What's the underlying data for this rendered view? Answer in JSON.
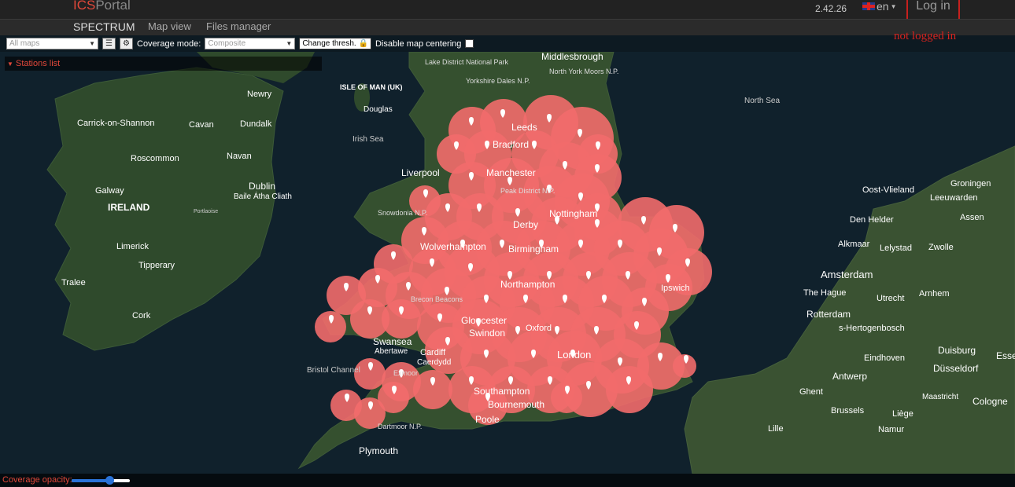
{
  "header": {
    "logo_part1": "ICS",
    "logo_part2": "Portal",
    "version": "2.42.26",
    "language": "en",
    "login_label": "Log in",
    "annotation": "not logged in"
  },
  "nav": {
    "items": [
      {
        "label": "SPECTRUM",
        "active": true
      },
      {
        "label": "Map view",
        "active": false
      },
      {
        "label": "Files manager",
        "active": false
      }
    ]
  },
  "toolbar": {
    "maps_select_value": "All maps",
    "coverage_mode_label": "Coverage mode:",
    "coverage_mode_value": "Composite",
    "change_thresh_label": "Change thresh.",
    "disable_centering_label": "Disable map centering",
    "disable_centering_checked": false
  },
  "stations_list_label": "Stations list",
  "coverage_opacity": {
    "label": "Coverage opacity:",
    "value": 0.65
  },
  "map": {
    "colors": {
      "sea": "#10212c",
      "land": "#2f4a2c",
      "coverage": "#f26b6b",
      "marker": "#ffffff"
    },
    "labels": [
      {
        "text": "Middlesbrough",
        "kind": "city"
      },
      {
        "text": "Lake District National Park",
        "kind": "park"
      },
      {
        "text": "Yorkshire Dales N.P.",
        "kind": "park"
      },
      {
        "text": "North York Moors N.P.",
        "kind": "park"
      },
      {
        "text": "ISLE OF MAN (UK)",
        "kind": "region"
      },
      {
        "text": "Douglas",
        "kind": "city"
      },
      {
        "text": "North Sea",
        "kind": "water"
      },
      {
        "text": "Irish Sea",
        "kind": "water"
      },
      {
        "text": "Newry",
        "kind": "city"
      },
      {
        "text": "Carrick-on-Shannon",
        "kind": "city"
      },
      {
        "text": "Cavan",
        "kind": "city"
      },
      {
        "text": "Dundalk",
        "kind": "city"
      },
      {
        "text": "Roscommon",
        "kind": "city"
      },
      {
        "text": "Navan",
        "kind": "city"
      },
      {
        "text": "Galway",
        "kind": "city"
      },
      {
        "text": "Dublin",
        "kind": "city"
      },
      {
        "text": "Baile Átha Cliath",
        "kind": "city"
      },
      {
        "text": "IRELAND",
        "kind": "country"
      },
      {
        "text": "Portlaoise",
        "kind": "town"
      },
      {
        "text": "Limerick",
        "kind": "city"
      },
      {
        "text": "Tipperary",
        "kind": "city"
      },
      {
        "text": "Tralee",
        "kind": "city"
      },
      {
        "text": "Cork",
        "kind": "city"
      },
      {
        "text": "Liverpool",
        "kind": "city"
      },
      {
        "text": "Manchester",
        "kind": "city"
      },
      {
        "text": "Leeds",
        "kind": "city"
      },
      {
        "text": "Bradford",
        "kind": "city"
      },
      {
        "text": "Peak District N.P.",
        "kind": "park"
      },
      {
        "text": "Snowdonia N.P.",
        "kind": "park"
      },
      {
        "text": "Nottingham",
        "kind": "city"
      },
      {
        "text": "Derby",
        "kind": "city"
      },
      {
        "text": "Wolverhampton",
        "kind": "city"
      },
      {
        "text": "Birmingham",
        "kind": "city"
      },
      {
        "text": "Northampton",
        "kind": "city"
      },
      {
        "text": "Brecon Beacons",
        "kind": "park"
      },
      {
        "text": "Gloucester",
        "kind": "city"
      },
      {
        "text": "Swindon",
        "kind": "city"
      },
      {
        "text": "Swansea",
        "kind": "city"
      },
      {
        "text": "Abertawe",
        "kind": "city"
      },
      {
        "text": "Cardiff",
        "kind": "city"
      },
      {
        "text": "Caerdydd",
        "kind": "city"
      },
      {
        "text": "Bristol Channel",
        "kind": "water"
      },
      {
        "text": "London",
        "kind": "city"
      },
      {
        "text": "Oxford",
        "kind": "city"
      },
      {
        "text": "Ipswich",
        "kind": "city"
      },
      {
        "text": "Southampton",
        "kind": "city"
      },
      {
        "text": "Bournemouth",
        "kind": "city"
      },
      {
        "text": "Poole",
        "kind": "city"
      },
      {
        "text": "Dartmoor N.P.",
        "kind": "park"
      },
      {
        "text": "Plymouth",
        "kind": "city"
      },
      {
        "text": "Exmoor",
        "kind": "park"
      },
      {
        "text": "Groningen",
        "kind": "city"
      },
      {
        "text": "Oost-Vlieland",
        "kind": "city"
      },
      {
        "text": "Leeuwarden",
        "kind": "city"
      },
      {
        "text": "Den Helder",
        "kind": "city"
      },
      {
        "text": "Assen",
        "kind": "city"
      },
      {
        "text": "Alkmaar",
        "kind": "city"
      },
      {
        "text": "Lelystad",
        "kind": "city"
      },
      {
        "text": "Zwolle",
        "kind": "city"
      },
      {
        "text": "Amsterdam",
        "kind": "city"
      },
      {
        "text": "The Hague",
        "kind": "city"
      },
      {
        "text": "Utrecht",
        "kind": "city"
      },
      {
        "text": "Arnhem",
        "kind": "city"
      },
      {
        "text": "Rotterdam",
        "kind": "city"
      },
      {
        "text": "s-Hertogenbosch",
        "kind": "city"
      },
      {
        "text": "Eindhoven",
        "kind": "city"
      },
      {
        "text": "Duisburg",
        "kind": "city"
      },
      {
        "text": "Düsseldorf",
        "kind": "city"
      },
      {
        "text": "Essen",
        "kind": "city"
      },
      {
        "text": "Antwerp",
        "kind": "city"
      },
      {
        "text": "Ghent",
        "kind": "city"
      },
      {
        "text": "Brussels",
        "kind": "city"
      },
      {
        "text": "Maastricht",
        "kind": "city"
      },
      {
        "text": "Liège",
        "kind": "city"
      },
      {
        "text": "Cologne",
        "kind": "city"
      },
      {
        "text": "Namur",
        "kind": "city"
      },
      {
        "text": "Lille",
        "kind": "city"
      }
    ]
  }
}
